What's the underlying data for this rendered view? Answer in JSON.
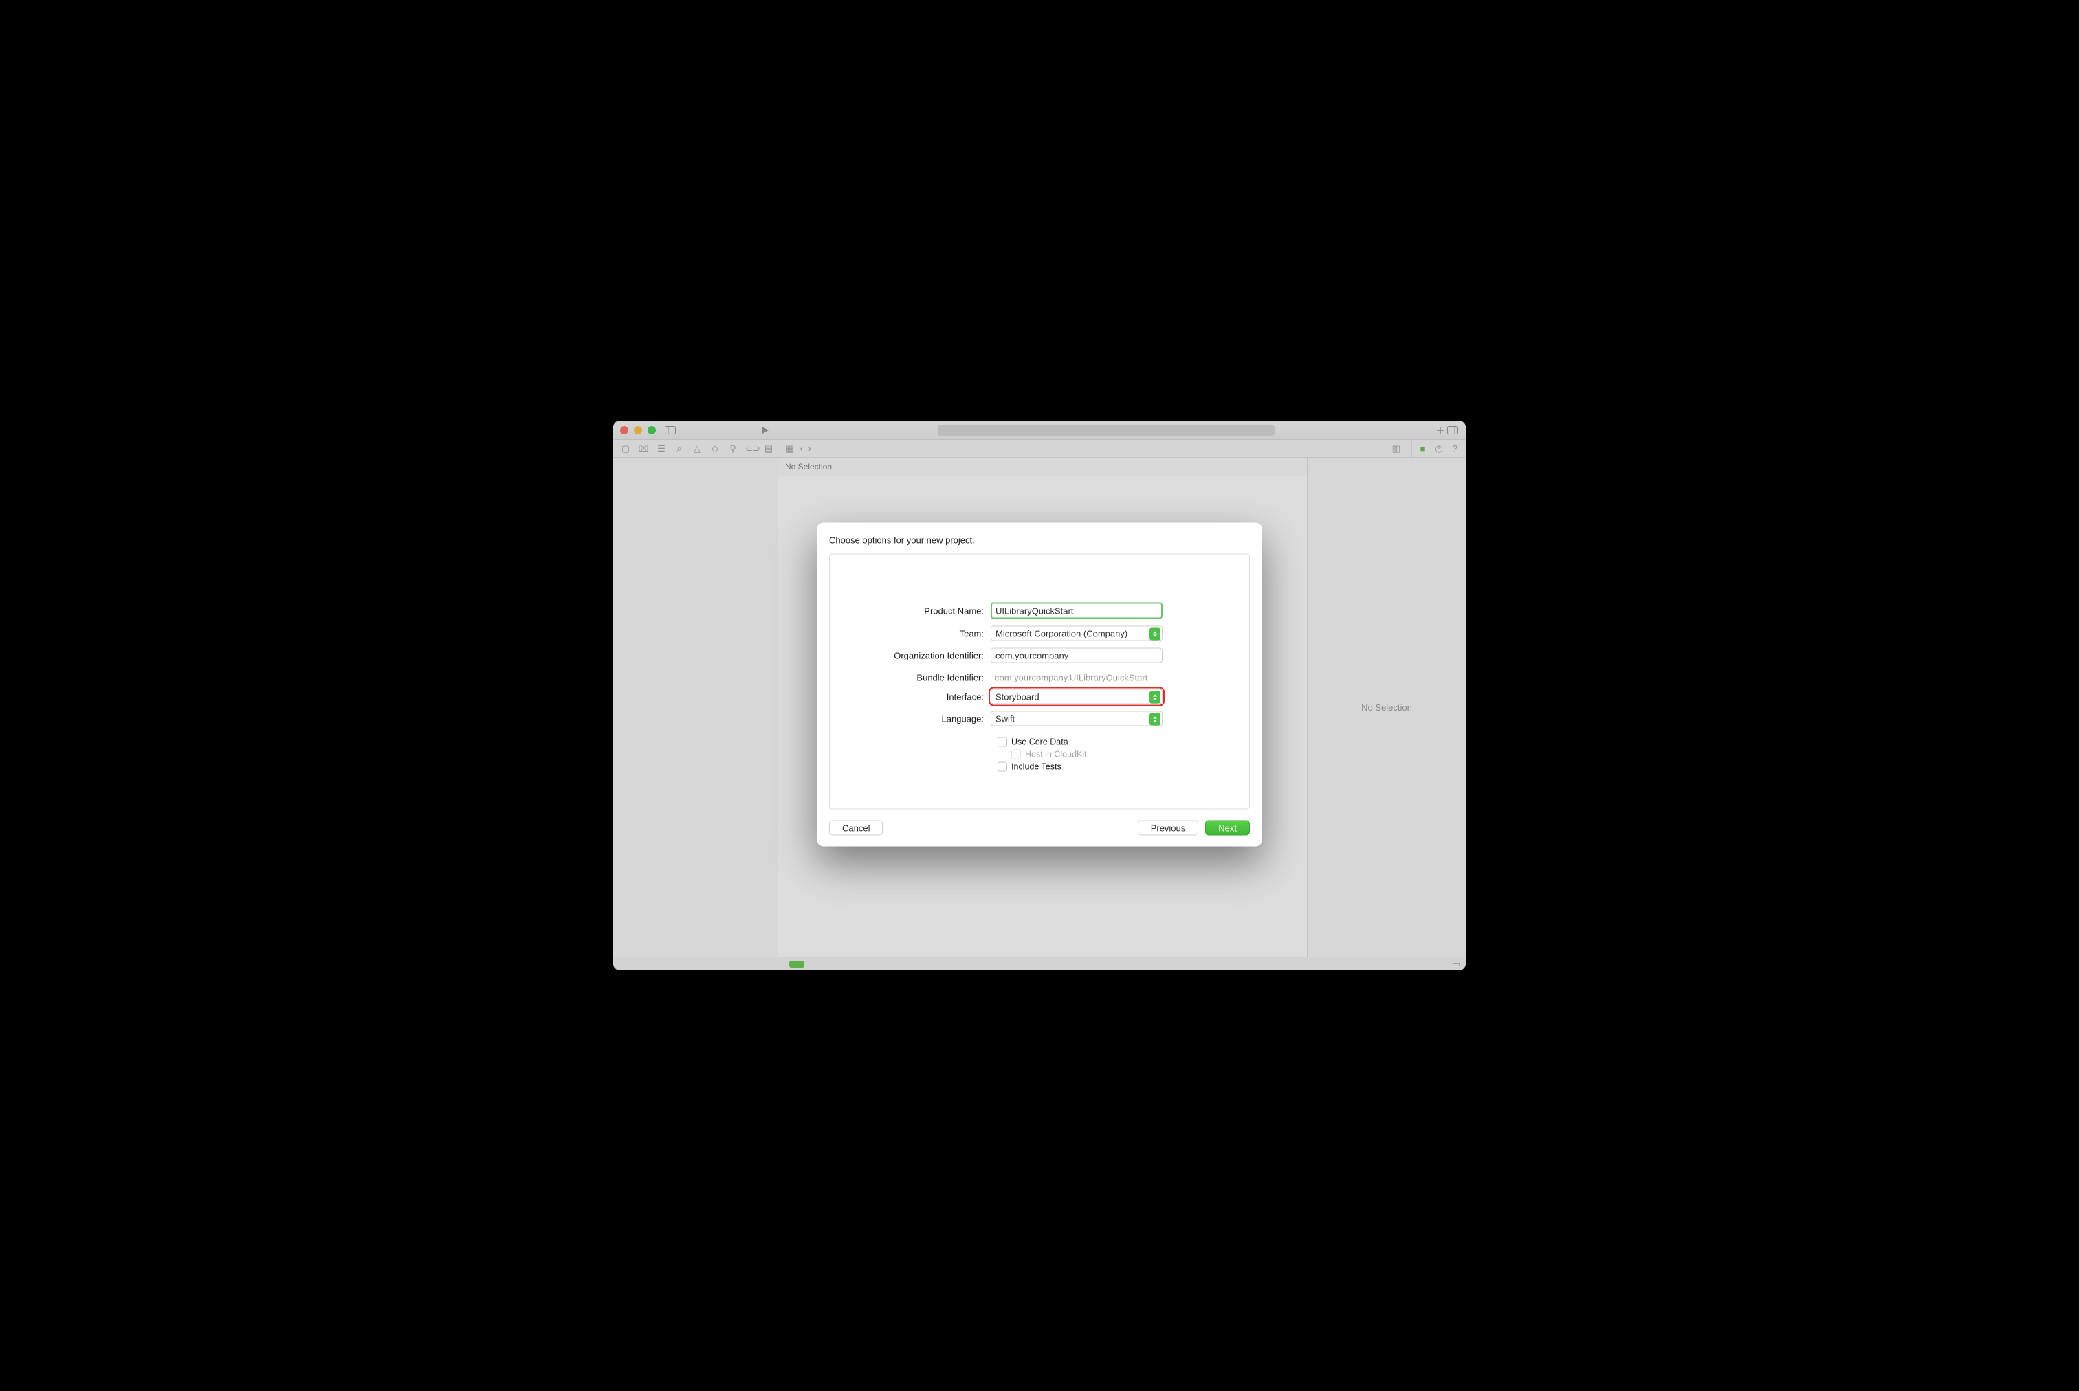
{
  "window": {
    "crumb": "No Selection"
  },
  "inspector": {
    "empty_text": "No Selection"
  },
  "dialog": {
    "title": "Choose options for your new project:",
    "labels": {
      "product_name": "Product Name:",
      "team": "Team:",
      "org_identifier": "Organization Identifier:",
      "bundle_identifier": "Bundle Identifier:",
      "interface": "Interface:",
      "language": "Language:"
    },
    "values": {
      "product_name": "UILibraryQuickStart",
      "team": "Microsoft Corporation (Company)",
      "org_identifier": "com.yourcompany",
      "bundle_identifier": "com.yourcompany.UILibraryQuickStart",
      "interface": "Storyboard",
      "language": "Swift"
    },
    "checkboxes": {
      "use_core_data": "Use Core Data",
      "host_cloudkit": "Host in CloudKit",
      "include_tests": "Include Tests"
    },
    "buttons": {
      "cancel": "Cancel",
      "previous": "Previous",
      "next": "Next"
    }
  }
}
